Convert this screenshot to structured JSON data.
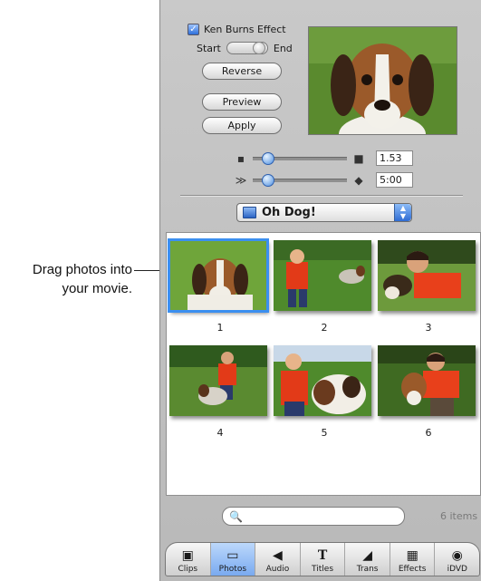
{
  "callout": {
    "text": "Drag photos into\nyour movie."
  },
  "ken_burns": {
    "label": "Ken Burns Effect",
    "checked": true,
    "start_label": "Start",
    "end_label": "End",
    "reverse_label": "Reverse",
    "preview_label": "Preview",
    "apply_label": "Apply"
  },
  "zoom_slider": {
    "value": "1.53",
    "level": 0.12
  },
  "duration_slider": {
    "value": "5:00",
    "level": 0.12
  },
  "album": {
    "selected": "Oh Dog!"
  },
  "photos": [
    {
      "number": "1",
      "selected": true
    },
    {
      "number": "2",
      "selected": false
    },
    {
      "number": "3",
      "selected": false
    },
    {
      "number": "4",
      "selected": false
    },
    {
      "number": "5",
      "selected": false
    },
    {
      "number": "6",
      "selected": false
    }
  ],
  "search": {
    "placeholder": ""
  },
  "status": {
    "count": "6 items"
  },
  "tabs": [
    {
      "label": "Clips",
      "icon": "clips-icon"
    },
    {
      "label": "Photos",
      "icon": "photos-icon",
      "active": true
    },
    {
      "label": "Audio",
      "icon": "audio-icon"
    },
    {
      "label": "Titles",
      "icon": "titles-icon"
    },
    {
      "label": "Trans",
      "icon": "transitions-icon"
    },
    {
      "label": "Effects",
      "icon": "effects-icon"
    },
    {
      "label": "iDVD",
      "icon": "idvd-icon"
    }
  ],
  "colors": {
    "accent": "#3b8ff0",
    "panel": "#c2c2c2"
  }
}
